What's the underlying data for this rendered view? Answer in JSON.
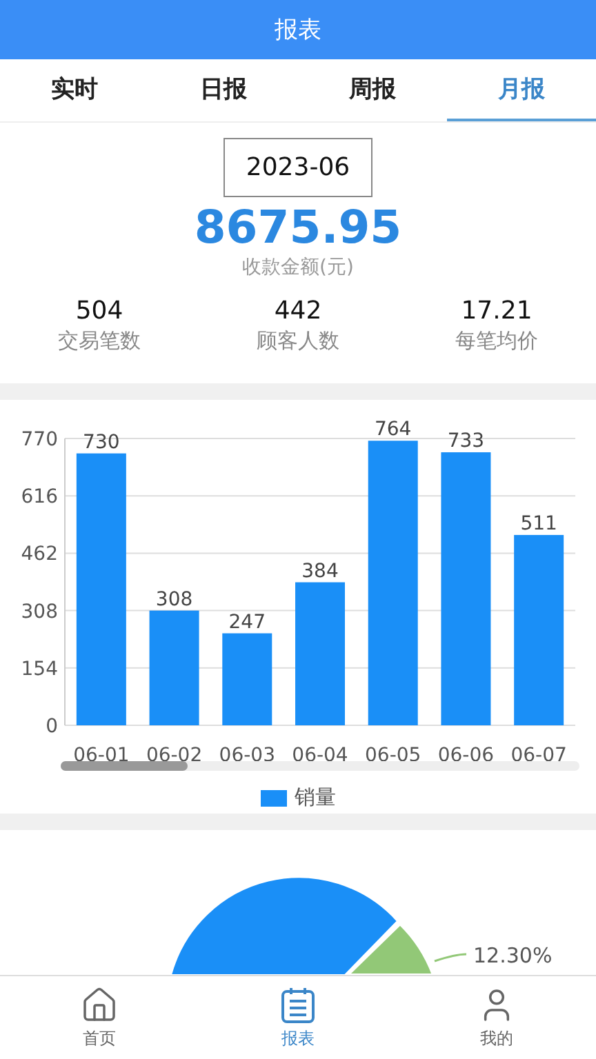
{
  "header": {
    "title": "报表"
  },
  "tabs": [
    {
      "label": "实时",
      "selected": false
    },
    {
      "label": "日报",
      "selected": false
    },
    {
      "label": "周报",
      "selected": false
    },
    {
      "label": "月报",
      "selected": true
    }
  ],
  "summary": {
    "date": "2023-06",
    "amount": "8675.95",
    "amount_label": "收款金额(元)",
    "stats": [
      {
        "value": "504",
        "label": "交易笔数"
      },
      {
        "value": "442",
        "label": "顾客人数"
      },
      {
        "value": "17.21",
        "label": "每笔均价"
      }
    ]
  },
  "sales_chart": {
    "chart_data": {
      "type": "bar",
      "categories": [
        "06-01",
        "06-02",
        "06-03",
        "06-04",
        "06-05",
        "06-06",
        "06-07"
      ],
      "series": [
        {
          "name": "销量",
          "color": "#1a8ff7",
          "values": [
            730,
            308,
            247,
            384,
            764,
            733,
            511
          ]
        }
      ],
      "ylim": [
        0,
        770
      ],
      "yticks": [
        0,
        154,
        308,
        462,
        616,
        770
      ],
      "grid": true,
      "data_labels": true
    }
  },
  "share_chart": {
    "slice_label": "12.30%"
  },
  "nav": [
    {
      "label": "首页",
      "kind": "home",
      "selected": false
    },
    {
      "label": "报表",
      "kind": "report",
      "selected": true
    },
    {
      "label": "我的",
      "kind": "profile",
      "selected": false
    }
  ]
}
